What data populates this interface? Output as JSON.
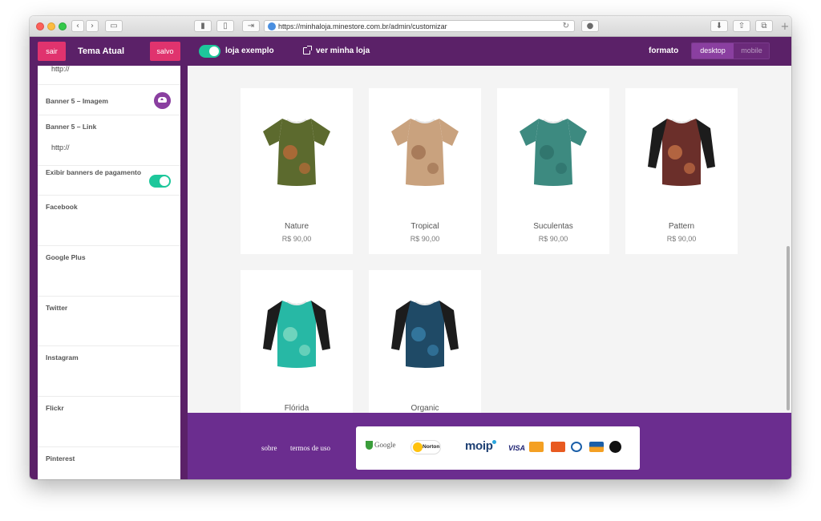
{
  "browser": {
    "url": "https://minhaloja.minestore.com.br/admin/customizar",
    "new_tab": "+"
  },
  "header": {
    "exit_label": "sair",
    "theme_title": "Tema Atual",
    "saved_label": "salvo",
    "sample_store_label": "loja exemplo",
    "view_store_label": "ver minha loja",
    "format_label": "formato",
    "desktop_label": "desktop",
    "mobile_label": "mobile"
  },
  "sidebar": {
    "fields": [
      {
        "label": "",
        "value": "http://"
      },
      {
        "label": "Banner 5 – Imagem",
        "value": ""
      },
      {
        "label": "Banner 5 – Link",
        "value": "http://"
      },
      {
        "label": "Exibir banners de pagamento",
        "value": ""
      },
      {
        "label": "Facebook",
        "value": ""
      },
      {
        "label": "Google Plus",
        "value": ""
      },
      {
        "label": "Twitter",
        "value": ""
      },
      {
        "label": "Instagram",
        "value": ""
      },
      {
        "label": "Flickr",
        "value": ""
      },
      {
        "label": "Pinterest",
        "value": ""
      }
    ]
  },
  "products": [
    {
      "name": "Nature",
      "price": "R$ 90,00",
      "style": "tee",
      "color": "#5c6a2e",
      "accent": "#c96a3a"
    },
    {
      "name": "Tropical",
      "price": "R$ 90,00",
      "style": "tee",
      "color": "#c9a27e",
      "accent": "#9a6b4b"
    },
    {
      "name": "Suculentas",
      "price": "R$ 90,00",
      "style": "tee",
      "color": "#3d8a80",
      "accent": "#2c6d67"
    },
    {
      "name": "Pattern",
      "price": "R$ 90,00",
      "style": "raglan",
      "color": "#6b2f2a",
      "accent": "#d07a4a"
    },
    {
      "name": "Flórida",
      "price": "R$ 90,00",
      "style": "raglan",
      "color": "#27b8a5",
      "accent": "#8fe0c8"
    },
    {
      "name": "Organic",
      "price": "R$ 90,00",
      "style": "raglan",
      "color": "#1f4a66",
      "accent": "#3b87b3"
    }
  ],
  "footer": {
    "about_label": "sobre",
    "terms_label": "termos de uso",
    "seals": {
      "google": "Google",
      "norton": "Norton",
      "moip": "moip",
      "visa": "VISA"
    }
  },
  "colors": {
    "header_purple": "#5b2168",
    "footer_purple": "#6b2d8f",
    "accent_pink": "#e0336e",
    "toggle_green": "#1dc79b"
  }
}
